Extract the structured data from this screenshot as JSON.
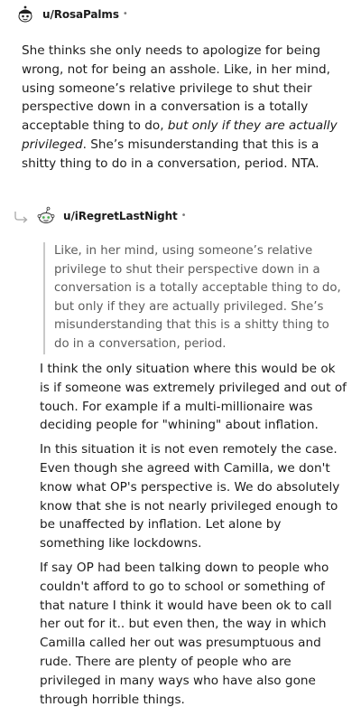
{
  "comments": [
    {
      "username": "u/RosaPalms",
      "separator": "•",
      "body_before": "She thinks she only needs to apologize for being wrong, not for being an asshole. Like, in her mind, using someone’s relative privilege to shut their perspective down in a conversation is a totally acceptable thing to do, ",
      "body_italic": "but only if they are actually privileged",
      "body_after": ". She’s misunderstanding that this is a shitty thing to do in a conversation, period. NTA."
    },
    {
      "username": "u/iRegretLastNight",
      "separator": "•",
      "quote": "Like, in her mind, using someone’s relative privilege to shut their perspective down in a conversation is a totally acceptable thing to do, but only if they are actually privileged. She’s misunderstanding that this is a shitty thing to do in a conversation, period.",
      "paragraphs": [
        "I think the only situation where this would be ok is if someone was extremely privileged and out of touch. For example if a multi-millionaire was deciding people for \"whining\" about inflation.",
        "In this situation it is not even remotely the case. Even though she agreed with Camilla, we don't know what OP's perspective is. We do absolutely know that she is not nearly privileged enough to be unaffected by inflation. Let alone by something like lockdowns.",
        "If say OP had been talking down to people who couldn't afford to go to school or something of that nature I think it would have been ok to call her out for it.. but even then, the way in which Camilla called her out was presumptuous and rude. There are plenty of people who are privileged in many ways who have also gone through horrible things."
      ]
    }
  ],
  "icons": {
    "reply": "reply-arrow-icon",
    "avatar1": "snoo-avatar-icon",
    "avatar2": "snoo-avatar-icon"
  }
}
